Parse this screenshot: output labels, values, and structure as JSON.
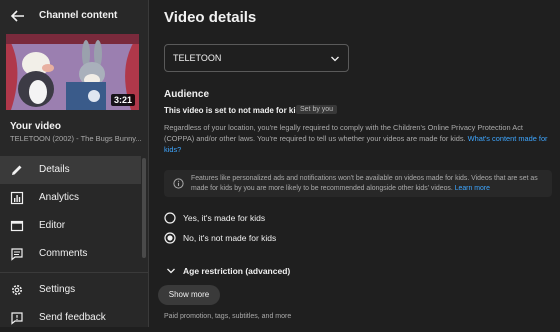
{
  "sidebar": {
    "title": "Channel content",
    "thumbnail_duration": "3:21",
    "your_video_label": "Your video",
    "video_name": "TELETOON (2002) - The Bugs Bunny...",
    "nav_items": [
      {
        "label": "Details",
        "icon": "pencil-icon",
        "active": true
      },
      {
        "label": "Analytics",
        "icon": "analytics-icon",
        "active": false
      },
      {
        "label": "Editor",
        "icon": "film-icon",
        "active": false
      },
      {
        "label": "Comments",
        "icon": "comment-icon",
        "active": false
      },
      {
        "label": "Settings",
        "icon": "gear-icon",
        "active": false
      },
      {
        "label": "Send feedback",
        "icon": "feedback-icon",
        "active": false
      }
    ]
  },
  "main": {
    "title": "Video details",
    "select_value": "TELETOON",
    "audience_title": "Audience",
    "kids_heading": "This video is set to not made for kids",
    "set_by_badge": "Set by you",
    "paragraph_text": "Regardless of your location, you're legally required to comply with the Children's Online Privacy Protection Act (COPPA) and/or other laws. You're required to tell us whether your videos are made for kids.",
    "paragraph_link": "What's content made for kids?",
    "info_text": "Features like personalized ads and notifications won't be available on videos made for kids. Videos that are set as made for kids by you are more likely to be recommended alongside other kids' videos.",
    "info_link": "Learn more",
    "radio_yes": "Yes, it's made for kids",
    "radio_no": "No, it's not made for kids",
    "selected_radio": "no",
    "age_restriction": "Age restriction (advanced)",
    "show_more": "Show more",
    "footer_note": "Paid promotion, tags, subtitles, and more"
  },
  "colors": {
    "background": "#1f1f1f",
    "sidebar": "#282828",
    "link": "#3ea6ff",
    "text": "#f1f1f1",
    "secondary_text": "#aaaaaa"
  }
}
